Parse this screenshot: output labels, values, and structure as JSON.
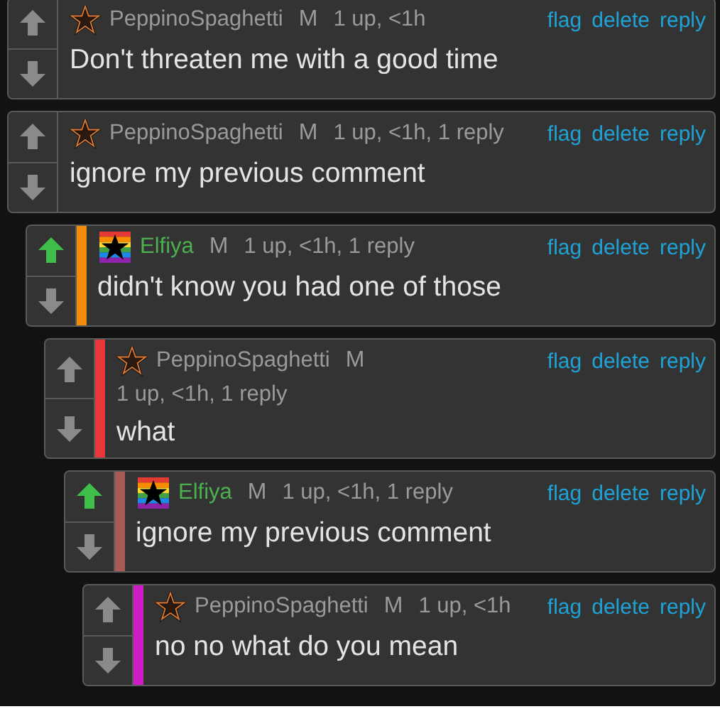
{
  "comments": [
    {
      "user": "PeppinoSpaghetti",
      "kind": "star",
      "badge": "M",
      "meta": "1 up, <1h",
      "actions": [
        "flag",
        "delete",
        "reply"
      ],
      "body": "Don't threaten me with a good time",
      "upvoted": false
    },
    {
      "user": "PeppinoSpaghetti",
      "kind": "star",
      "badge": "M",
      "meta": "1 up, <1h, 1 reply",
      "actions": [
        "flag",
        "delete",
        "reply"
      ],
      "body": "ignore my previous comment",
      "upvoted": false,
      "children": [
        {
          "user": "Elfiya",
          "kind": "rainbow",
          "color": "#f28a0c",
          "badge": "M",
          "meta": "1 up, <1h, 1 reply",
          "actions": [
            "flag",
            "delete",
            "reply"
          ],
          "body": "didn't know you had one of those",
          "upvoted": true,
          "children": [
            {
              "user": "PeppinoSpaghetti",
              "kind": "star",
              "color": "#e8373a",
              "badge": "M",
              "meta": "1 up, <1h, 1 reply",
              "actions": [
                "flag",
                "delete",
                "reply"
              ],
              "body": "what",
              "upvoted": false,
              "children": [
                {
                  "user": "Elfiya",
                  "kind": "rainbow",
                  "color": "#a85a55",
                  "badge": "M",
                  "meta": "1 up, <1h, 1 reply",
                  "actions": [
                    "flag",
                    "delete",
                    "reply"
                  ],
                  "body": "ignore my previous comment",
                  "upvoted": true,
                  "children": [
                    {
                      "user": "PeppinoSpaghetti",
                      "kind": "star",
                      "color": "#d01cc4",
                      "badge": "M",
                      "meta": "1 up, <1h",
                      "actions": [
                        "flag",
                        "delete",
                        "reply"
                      ],
                      "body": "no no what do you mean",
                      "upvoted": false
                    }
                  ]
                }
              ]
            }
          ]
        }
      ]
    }
  ]
}
